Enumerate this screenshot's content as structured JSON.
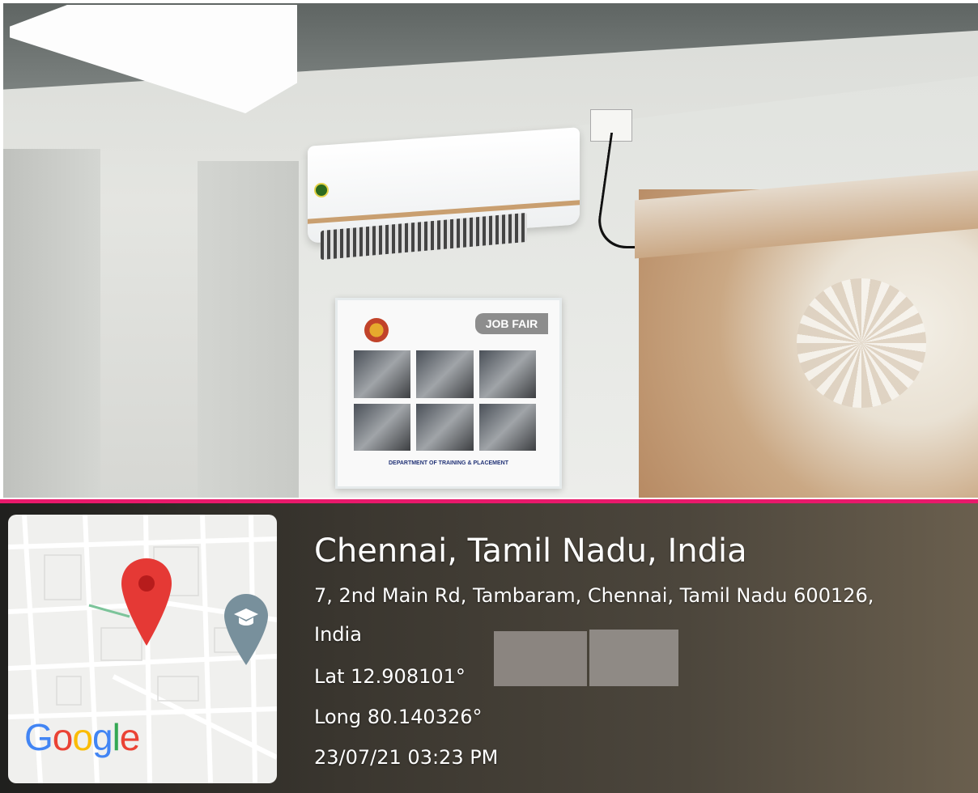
{
  "photo": {
    "poster_title": "JOB FAIR",
    "poster_footer": "DEPARTMENT OF TRAINING & PLACEMENT"
  },
  "colors": {
    "divider": "#e8196b",
    "pin": "#e53935",
    "school_marker": "#78909c"
  },
  "map": {
    "logo_letters": [
      {
        "ch": "G",
        "color": "#4285F4"
      },
      {
        "ch": "o",
        "color": "#EA4335"
      },
      {
        "ch": "o",
        "color": "#FBBC05"
      },
      {
        "ch": "g",
        "color": "#4285F4"
      },
      {
        "ch": "l",
        "color": "#34A853"
      },
      {
        "ch": "e",
        "color": "#EA4335"
      }
    ],
    "icons": [
      "location-pin-icon",
      "school-icon"
    ]
  },
  "location": {
    "city": "Chennai, Tamil Nadu, India",
    "address_line1": "7, 2nd Main Rd, Tambaram, Chennai, Tamil Nadu 600126,",
    "address_line2": "India",
    "latitude": "Lat 12.908101°",
    "longitude": "Long 80.140326°",
    "timestamp": "23/07/21 03:23 PM"
  }
}
